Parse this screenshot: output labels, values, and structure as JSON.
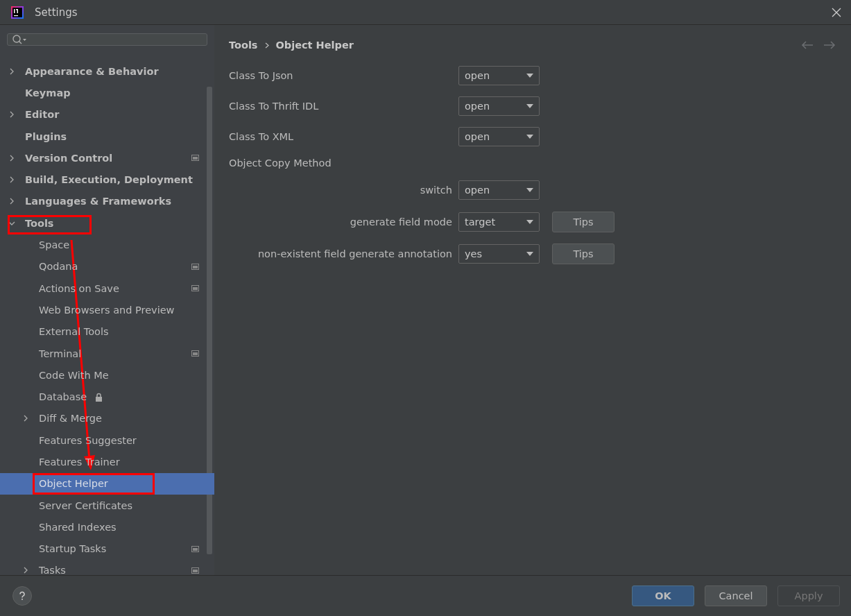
{
  "window": {
    "title": "Settings"
  },
  "sidebar": {
    "items": [
      {
        "kind": "plain",
        "label": "Appearance & Behavior",
        "expanded": false,
        "selected": false
      },
      {
        "kind": "plain",
        "label": "Keymap",
        "selected": false
      },
      {
        "kind": "plain",
        "label": "Editor",
        "expanded": false,
        "selected": false
      },
      {
        "kind": "plain",
        "label": "Plugins",
        "selected": false
      },
      {
        "kind": "project",
        "label": "Version Control",
        "expanded": false,
        "selected": false
      },
      {
        "kind": "plain",
        "label": "Build, Execution, Deployment",
        "expanded": false,
        "selected": false
      },
      {
        "kind": "plain",
        "label": "Languages & Frameworks",
        "expanded": false,
        "selected": false
      },
      {
        "kind": "plain",
        "label": "Tools",
        "expanded": true,
        "selected": false,
        "children": [
          {
            "kind": "plain",
            "label": "Space",
            "selected": false
          },
          {
            "kind": "project",
            "label": "Qodana",
            "selected": false
          },
          {
            "kind": "project",
            "label": "Actions on Save",
            "selected": false
          },
          {
            "kind": "plain",
            "label": "Web Browsers and Preview",
            "selected": false
          },
          {
            "kind": "plain",
            "label": "External Tools",
            "selected": false
          },
          {
            "kind": "project",
            "label": "Terminal",
            "selected": false
          },
          {
            "kind": "plain",
            "label": "Code With Me",
            "selected": false
          },
          {
            "kind": "lock",
            "label": "Database",
            "selected": false
          },
          {
            "kind": "plain",
            "label": "Diff & Merge",
            "expanded": false,
            "selected": false
          },
          {
            "kind": "plain",
            "label": "Features Suggester",
            "selected": false
          },
          {
            "kind": "plain",
            "label": "Features Trainer",
            "selected": false
          },
          {
            "kind": "plain",
            "label": "Object Helper",
            "selected": true
          },
          {
            "kind": "plain",
            "label": "Server Certificates",
            "selected": false
          },
          {
            "kind": "plain",
            "label": "Shared Indexes",
            "selected": false
          },
          {
            "kind": "project",
            "label": "Startup Tasks",
            "selected": false
          },
          {
            "kind": "project",
            "label": "Tasks",
            "expanded": false,
            "selected": false
          }
        ]
      }
    ]
  },
  "breadcrumb": [
    "Tools",
    "Object Helper"
  ],
  "settings": [
    {
      "kind": "select",
      "label": "Class To Json",
      "value": "open"
    },
    {
      "kind": "select",
      "label": "Class To Thrift IDL",
      "value": "open"
    },
    {
      "kind": "select",
      "label": "Class To XML",
      "value": "open"
    },
    {
      "kind": "heading",
      "label": "Object Copy Method"
    },
    {
      "kind": "subselect",
      "label": "switch",
      "value": "open"
    },
    {
      "kind": "subselect",
      "label": "generate field mode",
      "value": "target",
      "button": "Tips"
    },
    {
      "kind": "subselect",
      "label": "non-existent field generate annotation",
      "value": "yes",
      "button": "Tips"
    }
  ],
  "buttons": [
    {
      "label": "OK",
      "kind": "primary"
    },
    {
      "label": "Cancel",
      "kind": "normal"
    },
    {
      "label": "Apply",
      "kind": "disabled"
    }
  ]
}
